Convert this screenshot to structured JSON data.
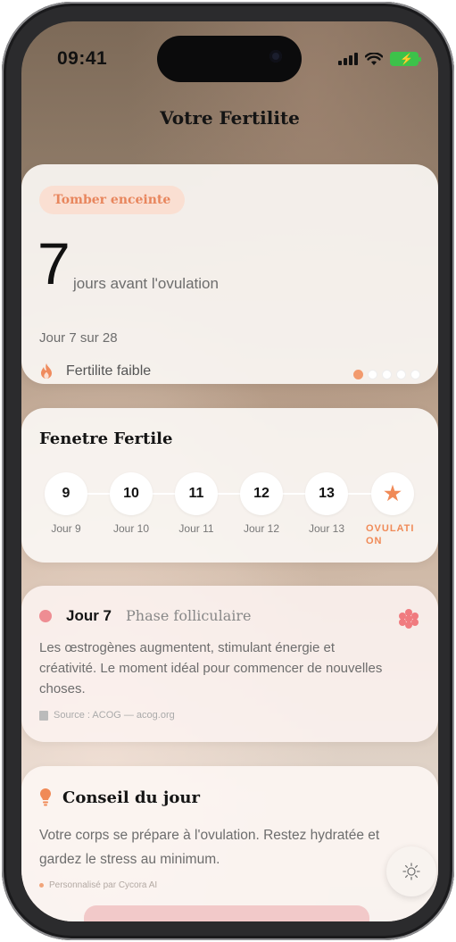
{
  "status": {
    "time": "09:41"
  },
  "page": {
    "title": "Votre Fertilite"
  },
  "cycle_card": {
    "badge": "Tomber enceinte",
    "days_count": "7",
    "days_label": "jours avant l'ovulation",
    "day_of": "Jour 7 sur 28",
    "fertility_level": "Fertilite faible",
    "page_dots": {
      "count": 5,
      "active_index": 0
    }
  },
  "window_card": {
    "title": "Fenetre Fertile",
    "days": [
      {
        "num": "9",
        "label": "Jour 9"
      },
      {
        "num": "10",
        "label": "Jour 10"
      },
      {
        "num": "11",
        "label": "Jour 11"
      },
      {
        "num": "12",
        "label": "Jour 12"
      },
      {
        "num": "13",
        "label": "Jour 13"
      },
      {
        "num": "★",
        "label": "OVULATI ON"
      }
    ]
  },
  "phase_card": {
    "day": "Jour 7",
    "phase": "Phase folliculaire",
    "description": "Les œstrogènes augmentent, stimulant énergie et créativité. Le moment idéal pour commencer de nouvelles choses.",
    "source": "Source : ACOG — acog.org"
  },
  "tip_card": {
    "title": "Conseil du jour",
    "description": "Votre corps se prépare à l'ovulation. Restez hydratée et gardez le stress au minimum.",
    "ai_note": "Personnalisé par Cycora AI"
  },
  "colors": {
    "accent": "#f08a57",
    "phase": "#ee8d93",
    "badge_bg": "#fadfd2"
  },
  "icons": {
    "fertility": "flame-icon",
    "source": "book-icon",
    "tip": "lightbulb-icon",
    "theme": "sun-icon",
    "phase": "flower-icon",
    "ovulation": "star-icon"
  }
}
